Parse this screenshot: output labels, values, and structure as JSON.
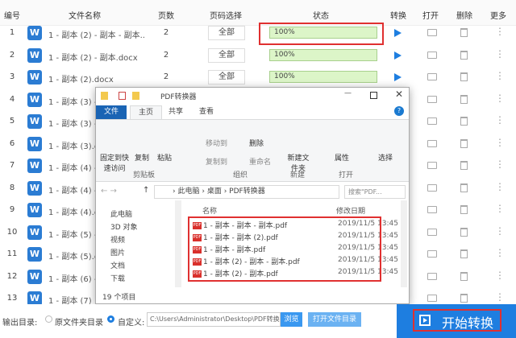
{
  "table": {
    "headers": [
      "编号",
      "文件名称",
      "页数",
      "页码选择",
      "状态",
      "转换",
      "打开",
      "删除",
      "更多"
    ],
    "rows": [
      {
        "no": "1",
        "name": "1 - 副本 (2) - 副本 - 副本....",
        "pages": "2",
        "range": "全部",
        "progress": "100%"
      },
      {
        "no": "2",
        "name": "1 - 副本 (2) - 副本.docx",
        "pages": "2",
        "range": "全部",
        "progress": "100%"
      },
      {
        "no": "3",
        "name": "1 - 副本 (2).docx",
        "pages": "2",
        "range": "全部",
        "progress": "100%"
      },
      {
        "no": "4",
        "name": "1 - 副本 (3) -"
      },
      {
        "no": "5",
        "name": "1 - 副本 (3) -"
      },
      {
        "no": "6",
        "name": "1 - 副本 (3).d"
      },
      {
        "no": "7",
        "name": "1 - 副本 (4) -"
      },
      {
        "no": "8",
        "name": "1 - 副本 (4) -"
      },
      {
        "no": "9",
        "name": "1 - 副本 (4).d"
      },
      {
        "no": "10",
        "name": "1 - 副本 (5) -"
      },
      {
        "no": "11",
        "name": "1 - 副本 (5).d"
      },
      {
        "no": "12",
        "name": "1 - 副本 (6) -"
      },
      {
        "no": "13",
        "name": "1 - 副本 (7)"
      }
    ],
    "word_icon": "W"
  },
  "explorer": {
    "title": "PDF转换器",
    "tabs": [
      "文件",
      "主页",
      "共享",
      "查看"
    ],
    "ribbon": {
      "pin": "固定到快速访问",
      "copy": "复制",
      "paste": "粘贴",
      "move_to": "移动到",
      "delete": "删除",
      "copy_to": "复制到",
      "rename": "重命名",
      "new_folder": "新建文件夹",
      "properties": "属性",
      "select": "选择",
      "groups": [
        "剪贴板",
        "组织",
        "新建",
        "打开"
      ]
    },
    "breadcrumb": [
      "此电脑",
      "桌面",
      "PDF转换器"
    ],
    "search_placeholder": "搜索\"PDF...",
    "nav": [
      "此电脑",
      "3D 对象",
      "视频",
      "图片",
      "文档",
      "下载"
    ],
    "columns": [
      "名称",
      "修改日期"
    ],
    "files": [
      {
        "name": "1 - 副本 - 副本 - 副本.pdf",
        "date": "2019/11/5 13:45"
      },
      {
        "name": "1 - 副本 - 副本 (2).pdf",
        "date": "2019/11/5 13:45"
      },
      {
        "name": "1 - 副本 - 副本.pdf",
        "date": "2019/11/5 13:45"
      },
      {
        "name": "1 - 副本 (2) - 副本 - 副本.pdf",
        "date": "2019/11/5 13:45"
      },
      {
        "name": "1 - 副本 (2) - 副本.pdf",
        "date": "2019/11/5 13:45"
      }
    ],
    "status": "19 个项目"
  },
  "output": {
    "label": "输出目录:",
    "option_original": "原文件夹目录",
    "option_custom": "自定义:",
    "path": "C:\\Users\\Administrator\\Desktop\\PDF转换",
    "browse": "浏览",
    "open_dir": "打开文件目录",
    "start": "开始转换"
  },
  "colors": {
    "accent": "#1e7ee0",
    "progress": "#dcf5c8",
    "highlight": "#e03030"
  }
}
